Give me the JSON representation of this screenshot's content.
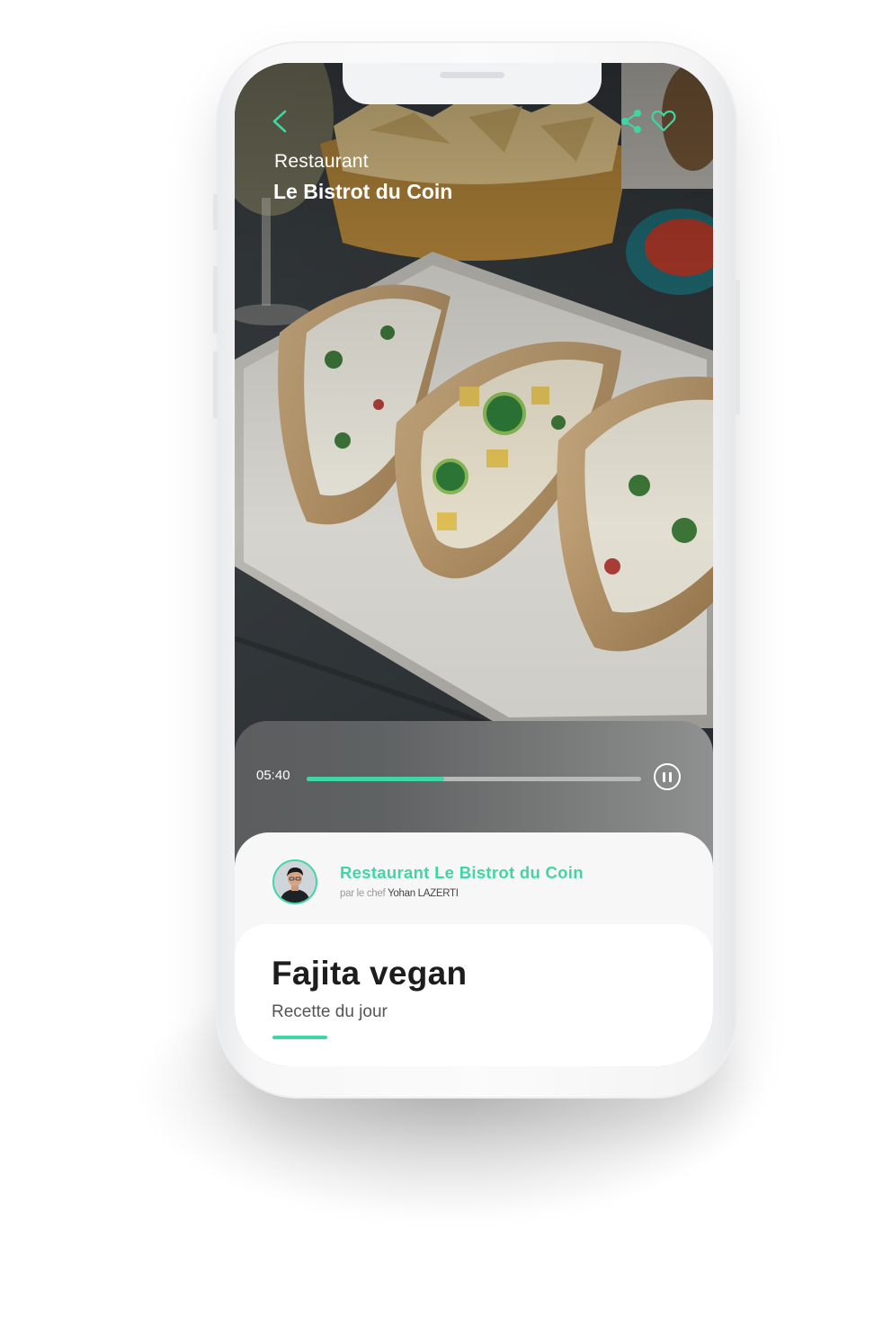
{
  "colors": {
    "accent": "#3fd6a3",
    "text_dark": "#1d1d1d",
    "text_muted": "#9a9a9a"
  },
  "icons": {
    "back": "back-chevron-icon",
    "share": "share-icon",
    "favorite": "heart-icon",
    "pause": "pause-icon"
  },
  "header": {
    "kicker": "Restaurant",
    "title": "Le Bistrot du Coin"
  },
  "player": {
    "time": "05:40",
    "progress": 0.41
  },
  "chef_card": {
    "restaurant": "Restaurant Le Bistrot du Coin",
    "by_prefix": "par le chef",
    "chef_name": "Yohan LAZERTI"
  },
  "recipe": {
    "title": "Fajita vegan",
    "subtitle": "Recette du jour"
  }
}
